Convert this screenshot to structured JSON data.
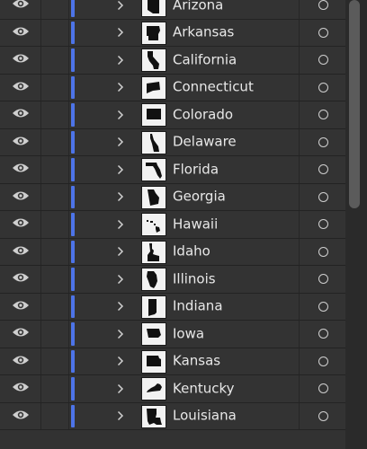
{
  "layers": [
    {
      "name": "Arizona",
      "shape": "az"
    },
    {
      "name": "Arkansas",
      "shape": "ar"
    },
    {
      "name": "California",
      "shape": "ca"
    },
    {
      "name": "Connecticut",
      "shape": "ct"
    },
    {
      "name": "Colorado",
      "shape": "co"
    },
    {
      "name": "Delaware",
      "shape": "de"
    },
    {
      "name": "Florida",
      "shape": "fl"
    },
    {
      "name": "Georgia",
      "shape": "ga"
    },
    {
      "name": "Hawaii",
      "shape": "hi"
    },
    {
      "name": "Idaho",
      "shape": "id"
    },
    {
      "name": "Illinois",
      "shape": "il"
    },
    {
      "name": "Indiana",
      "shape": "in"
    },
    {
      "name": "Iowa",
      "shape": "ia"
    },
    {
      "name": "Kansas",
      "shape": "ks"
    },
    {
      "name": "Kentucky",
      "shape": "ky"
    },
    {
      "name": "Louisiana",
      "shape": "la"
    }
  ],
  "icons": {
    "visibility": "eye-icon",
    "expand": "chevron-right-icon",
    "target": "target-circle-icon"
  },
  "colors": {
    "layer_color": "#4d74e8",
    "background": "#333333"
  }
}
